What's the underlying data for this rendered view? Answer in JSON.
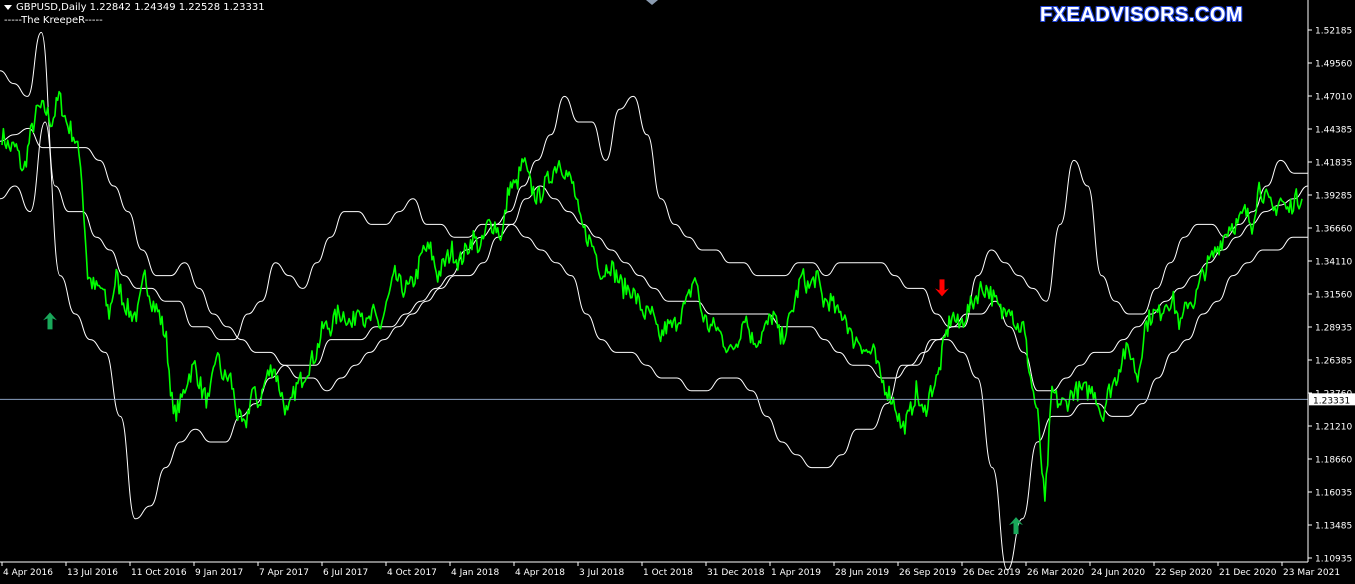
{
  "header": {
    "symbol_line": "GBPUSD,Daily  1.22842 1.24349 1.22528 1.23331",
    "indicator_line": "-----The KreepeR-----",
    "brand": "FXEADVISORS.COM"
  },
  "colors": {
    "background": "#000000",
    "price": "#00ff00",
    "bands": "#ffffff",
    "current_line": "#8aa0c0",
    "price_label_bg": "#ffffff",
    "buy_arrow": "#19a85a",
    "sell_arrow": "#ff0000",
    "axis": "#ffffff"
  },
  "icons": {
    "buy": "green-up-arrow-icon",
    "sell": "red-down-arrow-icon",
    "scroll": "chart-shift-marker-icon"
  },
  "chart_data": {
    "type": "line",
    "title": "",
    "xlabel": "",
    "ylabel": "",
    "ylim": [
      1.1,
      1.53
    ],
    "current_price": "1.23331",
    "y_ticks": [
      "1.52185",
      "1.49560",
      "1.47010",
      "1.44385",
      "1.41835",
      "1.39285",
      "1.36660",
      "1.34110",
      "1.31560",
      "1.28935",
      "1.26385",
      "1.23760",
      "1.21210",
      "1.18660",
      "1.16035",
      "1.13485",
      "1.10935"
    ],
    "x_ticks": [
      "4 Apr 2016",
      "13 Jul 2016",
      "11 Oct 2016",
      "9 Jan 2017",
      "7 Apr 2017",
      "6 Jul 2017",
      "4 Oct 2017",
      "4 Jan 2018",
      "4 Apr 2018",
      "3 Jul 2018",
      "1 Oct 2018",
      "31 Dec 2018",
      "1 Apr 2019",
      "28 Jun 2019",
      "26 Sep 2019",
      "26 Dec 2019",
      "26 Mar 2020",
      "24 Jun 2020",
      "22 Sep 2020",
      "21 Dec 2020",
      "23 Mar 2021"
    ],
    "series": [
      {
        "values": [
          1.44,
          1.43,
          1.43,
          1.41,
          1.44,
          1.46,
          1.46,
          1.45,
          1.47,
          1.45,
          1.44,
          1.42,
          1.33,
          1.32,
          1.32,
          1.3,
          1.33,
          1.31,
          1.3,
          1.3,
          1.33,
          1.31,
          1.3,
          1.28,
          1.22,
          1.23,
          1.25,
          1.26,
          1.24,
          1.23,
          1.27,
          1.25,
          1.25,
          1.22,
          1.21,
          1.24,
          1.23,
          1.25,
          1.26,
          1.24,
          1.22,
          1.24,
          1.25,
          1.26,
          1.27,
          1.29,
          1.29,
          1.3,
          1.3,
          1.29,
          1.31,
          1.29,
          1.3,
          1.29,
          1.31,
          1.33,
          1.32,
          1.32,
          1.33,
          1.35,
          1.35,
          1.33,
          1.34,
          1.35,
          1.34,
          1.35,
          1.36,
          1.35,
          1.37,
          1.37,
          1.36,
          1.4,
          1.4,
          1.42,
          1.4,
          1.39,
          1.4,
          1.41,
          1.42,
          1.41,
          1.4,
          1.37,
          1.36,
          1.35,
          1.33,
          1.34,
          1.33,
          1.32,
          1.32,
          1.31,
          1.3,
          1.3,
          1.28,
          1.29,
          1.29,
          1.3,
          1.31,
          1.33,
          1.3,
          1.29,
          1.29,
          1.28,
          1.27,
          1.28,
          1.3,
          1.28,
          1.28,
          1.29,
          1.3,
          1.28,
          1.29,
          1.31,
          1.33,
          1.32,
          1.33,
          1.31,
          1.31,
          1.3,
          1.3,
          1.28,
          1.28,
          1.27,
          1.27,
          1.25,
          1.24,
          1.23,
          1.21,
          1.22,
          1.24,
          1.22,
          1.24,
          1.25,
          1.28,
          1.3,
          1.29,
          1.3,
          1.31,
          1.32,
          1.32,
          1.31,
          1.3,
          1.31,
          1.29,
          1.29,
          1.25,
          1.22,
          1.15,
          1.24,
          1.23,
          1.23,
          1.24,
          1.24,
          1.24,
          1.24,
          1.22,
          1.24,
          1.25,
          1.27,
          1.27,
          1.25,
          1.29,
          1.3,
          1.3,
          1.31,
          1.31,
          1.29,
          1.31,
          1.31,
          1.33,
          1.34,
          1.35,
          1.36,
          1.37,
          1.37,
          1.38,
          1.37,
          1.4,
          1.39,
          1.38,
          1.39,
          1.38,
          1.39,
          1.39
        ]
      },
      {
        "values": [
          1.435,
          1.44,
          1.445,
          1.43,
          1.43,
          1.43,
          1.43,
          1.42,
          1.4,
          1.38,
          1.35,
          1.33,
          1.33,
          1.34,
          1.32,
          1.3,
          1.29,
          1.28,
          1.27,
          1.27,
          1.26,
          1.25,
          1.25,
          1.24,
          1.25,
          1.26,
          1.27,
          1.28,
          1.29,
          1.3,
          1.31,
          1.32,
          1.33,
          1.33,
          1.34,
          1.36,
          1.37,
          1.39,
          1.4,
          1.39,
          1.38,
          1.37,
          1.36,
          1.35,
          1.34,
          1.33,
          1.32,
          1.31,
          1.31,
          1.31,
          1.3,
          1.3,
          1.3,
          1.3,
          1.3,
          1.29,
          1.29,
          1.29,
          1.28,
          1.27,
          1.26,
          1.26,
          1.25,
          1.25,
          1.26,
          1.27,
          1.28,
          1.29,
          1.3,
          1.3,
          1.31,
          1.29,
          1.27,
          1.24,
          1.24,
          1.25,
          1.26,
          1.27,
          1.27,
          1.28,
          1.29,
          1.3,
          1.31,
          1.32,
          1.33,
          1.34,
          1.35,
          1.36,
          1.37,
          1.38,
          1.385,
          1.39,
          1.4
        ]
      },
      {
        "values": [
          1.49,
          1.48,
          1.47,
          1.52,
          1.4,
          1.38,
          1.38,
          1.36,
          1.35,
          1.33,
          1.32,
          1.32,
          1.31,
          1.31,
          1.29,
          1.29,
          1.28,
          1.28,
          1.3,
          1.31,
          1.34,
          1.33,
          1.32,
          1.34,
          1.36,
          1.38,
          1.38,
          1.37,
          1.37,
          1.38,
          1.39,
          1.37,
          1.37,
          1.36,
          1.36,
          1.37,
          1.37,
          1.38,
          1.4,
          1.42,
          1.44,
          1.47,
          1.45,
          1.45,
          1.42,
          1.46,
          1.47,
          1.44,
          1.39,
          1.37,
          1.36,
          1.35,
          1.35,
          1.34,
          1.34,
          1.33,
          1.33,
          1.33,
          1.34,
          1.34,
          1.33,
          1.34,
          1.34,
          1.34,
          1.34,
          1.33,
          1.32,
          1.32,
          1.3,
          1.29,
          1.29,
          1.33,
          1.35,
          1.34,
          1.33,
          1.32,
          1.31,
          1.37,
          1.42,
          1.4,
          1.33,
          1.31,
          1.3,
          1.3,
          1.32,
          1.34,
          1.36,
          1.37,
          1.37,
          1.36,
          1.37,
          1.38,
          1.4,
          1.42,
          1.41,
          1.41
        ]
      },
      {
        "values": [
          1.39,
          1.4,
          1.38,
          1.45,
          1.33,
          1.3,
          1.28,
          1.27,
          1.22,
          1.14,
          1.15,
          1.18,
          1.2,
          1.21,
          1.2,
          1.2,
          1.22,
          1.23,
          1.25,
          1.26,
          1.26,
          1.26,
          1.28,
          1.28,
          1.28,
          1.29,
          1.29,
          1.3,
          1.31,
          1.32,
          1.33,
          1.35,
          1.36,
          1.37,
          1.37,
          1.36,
          1.35,
          1.34,
          1.33,
          1.3,
          1.28,
          1.27,
          1.27,
          1.26,
          1.25,
          1.25,
          1.24,
          1.24,
          1.25,
          1.25,
          1.24,
          1.22,
          1.2,
          1.19,
          1.18,
          1.18,
          1.19,
          1.21,
          1.21,
          1.23,
          1.26,
          1.26,
          1.28,
          1.28,
          1.27,
          1.25,
          1.18,
          1.1,
          1.14,
          1.2,
          1.22,
          1.22,
          1.23,
          1.23,
          1.22,
          1.22,
          1.23,
          1.25,
          1.27,
          1.28,
          1.3,
          1.31,
          1.33,
          1.34,
          1.35,
          1.35,
          1.36,
          1.36
        ]
      }
    ],
    "markers": [
      {
        "type": "buy",
        "date": "Apr 2016",
        "price": 1.295
      },
      {
        "type": "sell",
        "date": "Nov 2019",
        "price": 1.32
      },
      {
        "type": "buy",
        "date": "Mar 2020",
        "price": 1.135
      }
    ]
  }
}
